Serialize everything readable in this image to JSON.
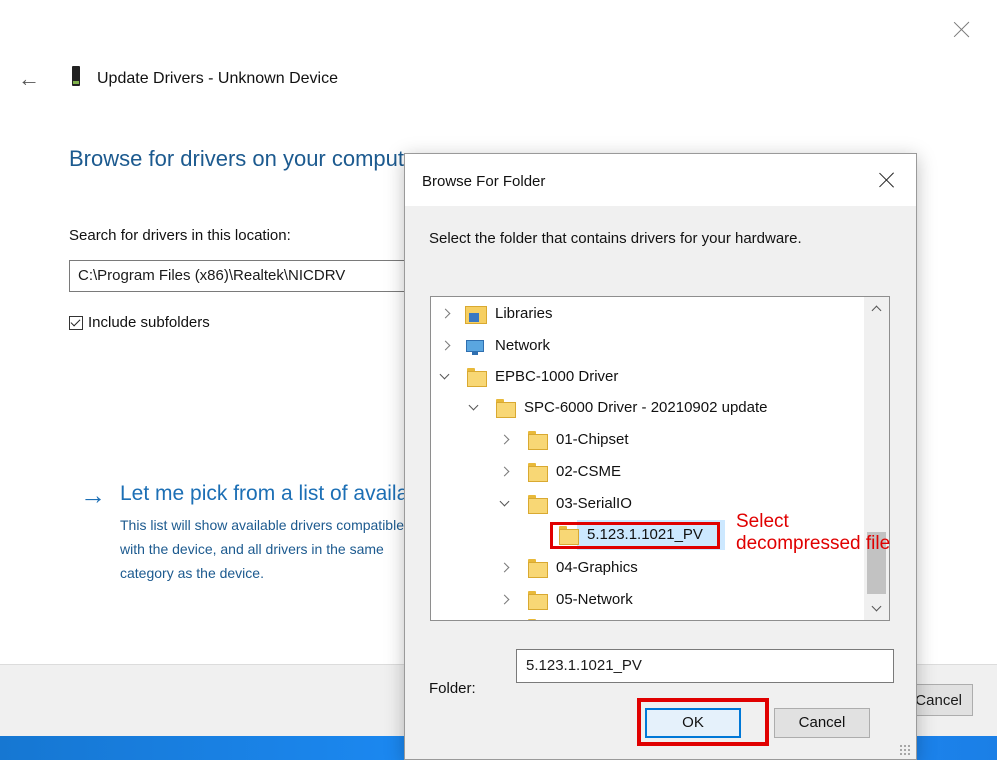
{
  "wizard": {
    "title": "Update Drivers - Unknown Device",
    "heading": "Browse for drivers on your computer",
    "search_label": "Search for drivers in this location:",
    "path_value": "C:\\Program Files (x86)\\Realtek\\NICDRV",
    "include_subfolders_label": "Include subfolders",
    "include_subfolders_checked": true,
    "pick_link": "Let me pick from a list of available drivers on my computer",
    "pick_desc": "This list will show available drivers compatible with the device, and all drivers in the same category as the device.",
    "cancel_label": "Cancel"
  },
  "dialog": {
    "title": "Browse For Folder",
    "instruction": "Select the folder that contains drivers for your hardware.",
    "tree": [
      {
        "label": "Libraries",
        "expander": "collapsed",
        "icon": "libraries-icon"
      },
      {
        "label": "Network",
        "expander": "collapsed",
        "icon": "network-icon"
      },
      {
        "label": "EPBC-1000 Driver",
        "expander": "expanded",
        "icon": "folder-icon"
      },
      {
        "label": "SPC-6000 Driver - 20210902 update",
        "expander": "expanded",
        "icon": "folder-icon"
      },
      {
        "label": "01-Chipset",
        "expander": "collapsed",
        "icon": "folder-icon"
      },
      {
        "label": "02-CSME",
        "expander": "collapsed",
        "icon": "folder-icon"
      },
      {
        "label": "03-SerialIO",
        "expander": "expanded",
        "icon": "folder-icon"
      },
      {
        "label": "5.123.1.1021_PV",
        "expander": "none",
        "icon": "folder-icon",
        "selected": true
      },
      {
        "label": "04-Graphics",
        "expander": "collapsed",
        "icon": "folder-icon"
      },
      {
        "label": "05-Network",
        "expander": "collapsed",
        "icon": "folder-icon"
      }
    ],
    "folder_label": "Folder:",
    "folder_value": "5.123.1.1021_PV",
    "ok_label": "OK",
    "cancel_label": "Cancel"
  },
  "annotation": {
    "text": "Select\ndecompressed file",
    "color": "#e00000"
  },
  "colors": {
    "link": "#1c6fb5",
    "heading": "#1c5a8f",
    "selection": "#cce8ff",
    "accent": "#0078d7"
  }
}
